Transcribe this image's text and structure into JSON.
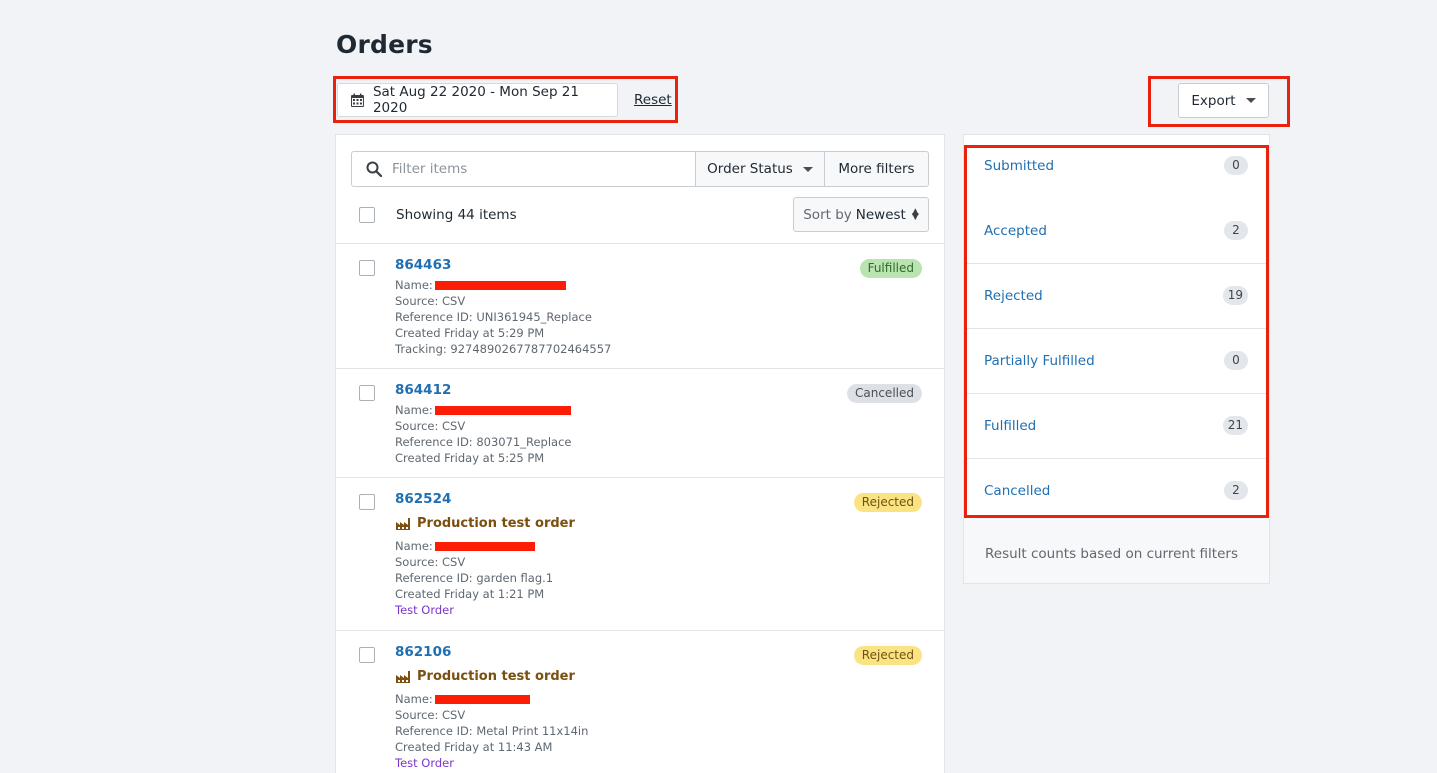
{
  "page": {
    "title": "Orders"
  },
  "toolbar": {
    "date_range": "Sat Aug 22 2020 - Mon Sep 21 2020",
    "reset_label": "Reset",
    "export_label": "Export"
  },
  "filters": {
    "search_placeholder": "Filter items",
    "order_status_label": "Order Status",
    "more_filters_label": "More filters",
    "showing": "Showing 44 items",
    "sort_prefix": "Sort by",
    "sort_value": "Newest"
  },
  "orders": [
    {
      "id": "864463",
      "status": "Fulfilled",
      "name_label": "Name:",
      "source": "Source: CSV",
      "reference": "Reference ID: UNI361945_Replace",
      "created": "Created Friday at 5:29 PM",
      "tracking": "Tracking: 9274890267787702464557"
    },
    {
      "id": "864412",
      "status": "Cancelled",
      "name_label": "Name:",
      "source": "Source: CSV",
      "reference": "Reference ID: 803071_Replace",
      "created": "Created Friday at 5:25 PM"
    },
    {
      "id": "862524",
      "status": "Rejected",
      "production": "Production test order",
      "name_label": "Name:",
      "source": "Source: CSV",
      "reference": "Reference ID: garden flag.1",
      "created": "Created Friday at 1:21 PM",
      "test_label": "Test Order"
    },
    {
      "id": "862106",
      "status": "Rejected",
      "production": "Production test order",
      "name_label": "Name:",
      "source": "Source: CSV",
      "reference": "Reference ID: Metal Print 11x14in",
      "created": "Created Friday at 11:43 AM",
      "test_label": "Test Order"
    }
  ],
  "status_counts": [
    {
      "label": "Submitted",
      "count": "0"
    },
    {
      "label": "Accepted",
      "count": "2"
    },
    {
      "label": "Rejected",
      "count": "19"
    },
    {
      "label": "Partially Fulfilled",
      "count": "0"
    },
    {
      "label": "Fulfilled",
      "count": "21"
    },
    {
      "label": "Cancelled",
      "count": "2"
    }
  ],
  "status_footnote": "Result counts based on current filters",
  "colors": {
    "link": "#1f6fb2",
    "highlight": "#e8220c",
    "fulfilled_badge": "#b9e3b0",
    "cancelled_badge": "#dde1e6",
    "rejected_badge": "#fbe383",
    "test_order": "#7a36c9"
  }
}
